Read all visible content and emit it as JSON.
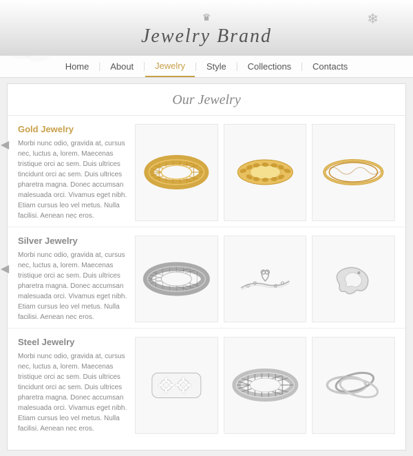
{
  "brand": {
    "title": "Jewelry Brand",
    "crown": "♛",
    "snowflake": "❄"
  },
  "nav": {
    "items": [
      {
        "label": "Home",
        "active": false
      },
      {
        "label": "About",
        "active": false
      },
      {
        "label": "Jewelry",
        "active": true
      },
      {
        "label": "Style",
        "active": false
      },
      {
        "label": "Collections",
        "active": false
      },
      {
        "label": "Contacts",
        "active": false
      }
    ]
  },
  "main": {
    "section_title": "Our Jewelry",
    "categories": [
      {
        "title": "Gold Jewelry",
        "description": "Morbi nunc odio, gravida at, cursus nec, luctus a, lorem. Maecenas tristique orci ac sem. Duis ultrices tincidunt orci ac sem. Duis ultrices pharetra magna. Donec accumsan malesuada orci. Vivamus eget nibh. Etiam cursus leo vel metus. Nulla facilisi. Aenean nec eros."
      },
      {
        "title": "Silver Jewelry",
        "description": "Morbi nunc odio, gravida at, cursus nec, luctus a, lorem. Maecenas tristique orci ac sem. Duis ultrices pharetra magna. Donec accumsan malesuada orci. Vivamus eget nibh. Etiam cursus leo vel metus. Nulla facilisi. Aenean nec eros."
      },
      {
        "title": "Steel Jewelry",
        "description": "Morbi nunc odio, gravida at, cursus nec, luctus a, lorem. Maecenas tristique orci ac sem. Duis ultrices tincidunt orci ac sem. Duis ultrices pharetra magna. Donec accumsan malesuada orci. Vivamus eget nibh. Etiam cursus leo vel metus. Nulla facilisi. Aenean nec eros."
      }
    ]
  }
}
